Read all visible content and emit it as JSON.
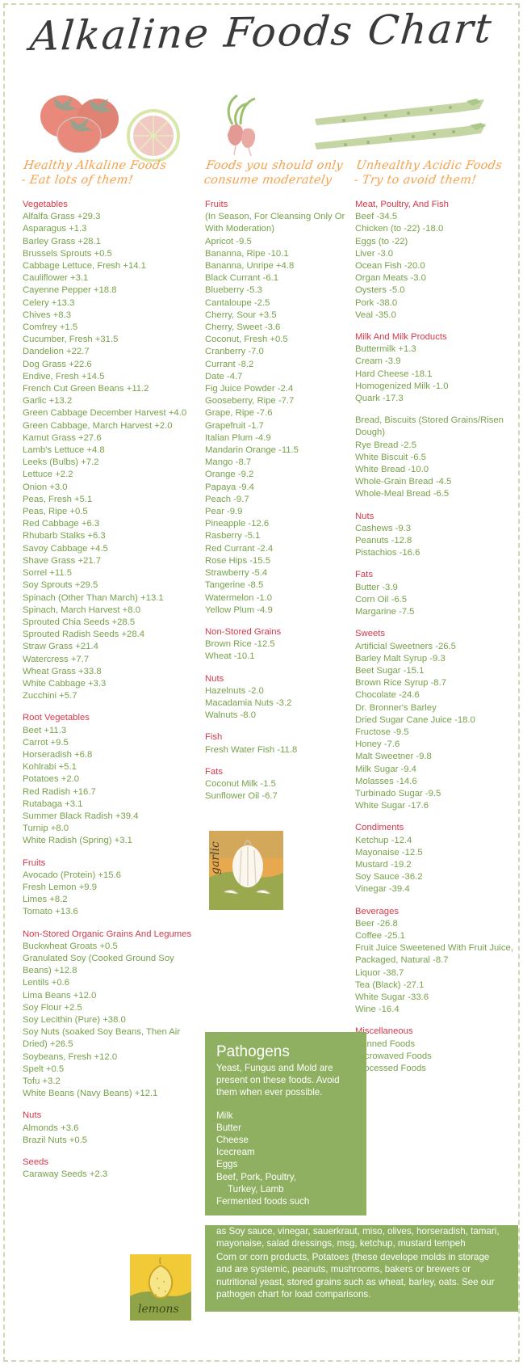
{
  "header": {
    "title": "Alkaline Foods Chart"
  },
  "artwork": [
    {
      "name": "tomatoes-illustration"
    },
    {
      "name": "lime-slice-illustration"
    },
    {
      "name": "radish-illustration"
    },
    {
      "name": "asparagus-illustration"
    },
    {
      "name": "garlic-painting",
      "caption": "garlic"
    },
    {
      "name": "lemons-painting",
      "caption": "lemons"
    }
  ],
  "colors": {
    "category_heading": "#d7384b",
    "item_text": "#76a24a",
    "column_heading": "#f7a14a",
    "pathogen_box": "#8fb060",
    "page_border": "#cfd9b4"
  },
  "columns": [
    {
      "heading": "Healthy Alkaline Foods\n- Eat lots of them!",
      "groups": [
        {
          "name": "Vegetables",
          "items": [
            "Alfalfa Grass +29.3",
            "Asparagus +1.3",
            "Barley Grass +28.1",
            "Brussels Sprouts +0.5",
            "Cabbage Lettuce, Fresh +14.1",
            "Cauliflower +3.1",
            "Cayenne Pepper +18.8",
            "Celery +13.3",
            "Chives +8.3",
            "Comfrey +1.5",
            "Cucumber, Fresh +31.5",
            "Dandelion +22.7",
            "Dog Grass +22.6",
            "Endive, Fresh +14.5",
            "French Cut Green Beans +11.2",
            "Garlic +13.2",
            "Green Cabbage December Harvest +4.0",
            "Green Cabbage, March Harvest +2.0",
            "Kamut Grass +27.6",
            "Lamb's Lettuce +4.8",
            "Leeks (Bulbs) +7.2",
            "Lettuce +2.2",
            "Onion +3.0",
            "Peas, Fresh +5.1",
            "Peas, Ripe +0.5",
            "Red Cabbage +6.3",
            "Rhubarb Stalks +6.3",
            "Savoy Cabbage +4.5",
            "Shave Grass +21.7",
            "Sorrel +11.5",
            "Soy Sprouts +29.5",
            "Spinach (Other Than March) +13.1",
            "Spinach, March Harvest +8.0",
            "Sprouted Chia Seeds +28.5",
            "Sprouted Radish Seeds +28.4",
            "Straw Grass +21.4",
            "Watercress +7.7",
            "Wheat Grass +33.8",
            "White Cabbage +3.3",
            "Zucchini +5.7"
          ]
        },
        {
          "name": "Root Vegetables",
          "items": [
            "Beet +11.3",
            "Carrot +9.5",
            "Horseradish +6.8",
            "Kohlrabi +5.1",
            "Potatoes +2.0",
            "Red Radish +16.7",
            "Rutabaga +3.1",
            "Summer Black Radish +39.4",
            "Turnip +8.0",
            "White Radish (Spring) +3.1"
          ]
        },
        {
          "name": "Fruits",
          "items": [
            "Avocado (Protein) +15.6",
            "Fresh Lemon +9.9",
            "Limes +8.2",
            "Tomato +13.6"
          ]
        },
        {
          "name": "Non-Stored Organic Grains And Legumes",
          "items": [
            "Buckwheat Groats +0.5",
            "Granulated Soy (Cooked Ground Soy Beans) +12.8",
            "Lentils +0.6",
            "Lima Beans +12.0",
            "Soy Flour +2.5",
            "Soy Lecithin (Pure) +38.0",
            "Soy Nuts (soaked Soy Beans, Then Air Dried) +26.5",
            "Soybeans, Fresh +12.0",
            "Spelt +0.5",
            "Tofu +3.2",
            "White Beans (Navy Beans) +12.1"
          ]
        },
        {
          "name": "Nuts",
          "items": [
            "Almonds +3.6",
            "Brazil Nuts +0.5"
          ]
        },
        {
          "name": "Seeds",
          "items": [
            "Caraway Seeds +2.3"
          ]
        }
      ]
    },
    {
      "heading": "Foods you should only\nconsume moderately",
      "groups": [
        {
          "name": "Fruits",
          "subtitle": "(In Season, For Cleansing Only Or With Moderation)",
          "items": [
            "Apricot -9.5",
            "Bananna, Ripe -10.1",
            "Bananna, Unripe +4.8",
            "Black Currant -6.1",
            "Blueberry -5.3",
            "Cantaloupe -2.5",
            "Cherry, Sour +3.5",
            "Cherry, Sweet -3.6",
            "Coconut, Fresh +0.5",
            "Cranberry -7.0",
            "Currant -8.2",
            "Date -4.7",
            "Fig Juice Powder -2.4",
            "Gooseberry, Ripe -7.7",
            "Grape, Ripe -7.6",
            "Grapefruit -1.7",
            "Italian Plum -4.9",
            "Mandarin Orange -11.5",
            "Mango -8.7",
            "Orange -9.2",
            "Papaya -9.4",
            "Peach -9.7",
            "Pear -9.9",
            "Pineapple -12.6",
            "Rasberry -5.1",
            "Red Currant -2.4",
            "Rose Hips -15.5",
            "Strawberry -5.4",
            "Tangerine -8.5",
            "Watermelon -1.0",
            "Yellow Plum -4.9"
          ]
        },
        {
          "name": "Non-Stored Grains",
          "items": [
            "Brown Rice -12.5",
            "Wheat -10.1"
          ]
        },
        {
          "name": "Nuts",
          "items": [
            "Hazelnuts -2.0",
            "Macadamia Nuts -3.2",
            "Walnuts -8.0"
          ]
        },
        {
          "name": "Fish",
          "items": [
            "Fresh Water Fish -11.8"
          ]
        },
        {
          "name": "Fats",
          "items": [
            "Coconut Milk -1.5",
            "Sunflower Oil -6.7"
          ]
        }
      ]
    },
    {
      "heading": "Unhealthy Acidic Foods\n- Try to avoid them!",
      "groups": [
        {
          "name": "Meat, Poultry, And Fish",
          "items": [
            "Beef -34.5",
            "Chicken (to -22) -18.0",
            "Eggs (to -22)",
            "Liver -3.0",
            "Ocean Fish -20.0",
            "Organ Meats -3.0",
            "Oysters -5.0",
            "Pork -38.0",
            "Veal -35.0"
          ]
        },
        {
          "name": "Milk And Milk Products",
          "items": [
            "Buttermilk +1.3",
            "Cream -3.9",
            "Hard Cheese -18.1",
            "Homogenized Milk -1.0",
            "Quark -17.3"
          ]
        },
        {
          "name": "Bread, Biscuits (Stored Grains/Risen Dough)",
          "heading_style": "green",
          "items": [
            "Rye Bread -2.5",
            "White Biscuit -6.5",
            "White Bread -10.0",
            "Whole-Grain Bread -4.5",
            "Whole-Meal Bread -6.5"
          ]
        },
        {
          "name": "Nuts",
          "items": [
            "Cashews -9.3",
            "Peanuts -12.8",
            "Pistachios -16.6"
          ]
        },
        {
          "name": "Fats",
          "items": [
            "Butter -3.9",
            "Corn Oil -6.5",
            "Margarine -7.5"
          ]
        },
        {
          "name": "Sweets",
          "items": [
            "Artificial Sweetners -26.5",
            "Barley Malt Syrup -9.3",
            "Beet Sugar -15.1",
            "Brown Rice Syrup -8.7",
            "Chocolate -24.6",
            "Dr. Bronner's Barley",
            "Dried Sugar Cane Juice -18.0",
            "Fructose -9.5",
            "Honey -7.6",
            "Malt Sweetner -9.8",
            "Milk Sugar -9.4",
            "Molasses -14.6",
            "Turbinado Sugar -9.5",
            "White Sugar -17.6"
          ]
        },
        {
          "name": "Condiments",
          "items": [
            "Ketchup -12.4",
            "Mayonaise -12.5",
            "Mustard -19.2",
            "Soy Sauce -36.2",
            "Vinegar -39.4"
          ]
        },
        {
          "name": "Beverages",
          "items": [
            "Beer -26.8",
            "Coffee -25.1",
            "Fruit Juice Sweetened With Fruit Juice, Packaged, Natural -8.7",
            "Liquor -38.7",
            "Tea (Black) -27.1",
            "White Sugar -33.6",
            "Wine -16.4"
          ]
        },
        {
          "name": "Miscellaneous",
          "items": [
            "Canned Foods",
            "Microwaved Foods",
            "Processed Foods"
          ]
        }
      ]
    }
  ],
  "pathogens": {
    "title": "Pathogens",
    "intro": "Yeast, Fungus and Mold are present on these foods.  Avoid them when ever possible.",
    "list": [
      {
        "text": "Milk",
        "indent": false
      },
      {
        "text": "Butter",
        "indent": false
      },
      {
        "text": "Cheese",
        "indent": false
      },
      {
        "text": "Icecream",
        "indent": false
      },
      {
        "text": "Eggs",
        "indent": false
      },
      {
        "text": "Beef, Pork, Poultry,",
        "indent": false
      },
      {
        "text": "Turkey, Lamb",
        "indent": true
      },
      {
        "text": "Fermented foods such",
        "indent": false
      }
    ],
    "paragraphs": [
      "as Soy sauce, vinegar, sauerkraut, miso, olives, horseradish, tamari, mayonaise, salad dressings, msg, ketchup, mustard tempeh",
      "Corn or corn products, Potatoes (these develope molds in storage and are systemic, peanuts, mushrooms, bakers or brewers or nutritional yeast,  stored grains such as wheat, barley, oats.  See our pathogen chart for load comparisons."
    ]
  }
}
